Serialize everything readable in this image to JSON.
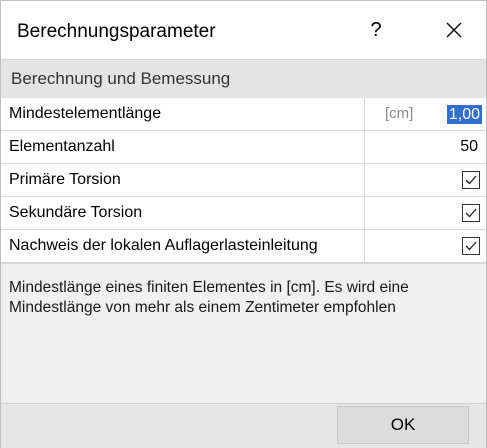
{
  "window": {
    "title": "Berechnungsparameter",
    "help_label": "?",
    "close_icon": "close-icon"
  },
  "section": {
    "title": "Berechnung und Bemessung"
  },
  "parameters": [
    {
      "label": "Mindestelementlänge",
      "unit": "[cm]",
      "value": "1,00",
      "selected": true
    },
    {
      "label": "Elementanzahl",
      "value": "50"
    },
    {
      "label": "Primäre Torsion",
      "checked": true
    },
    {
      "label": "Sekundäre Torsion",
      "checked": true
    },
    {
      "label": "Nachweis der lokalen Auflagerlasteinleitung",
      "checked": true
    }
  ],
  "description": {
    "text": "Mindestlänge eines finiten Elementes in [cm]. Es wird eine Mindestlänge von mehr als einem Zentimeter empfohlen"
  },
  "footer": {
    "ok_label": "OK"
  },
  "colors": {
    "selection": "#2f6fd0",
    "dialog_bg": "#f0f0f0"
  }
}
